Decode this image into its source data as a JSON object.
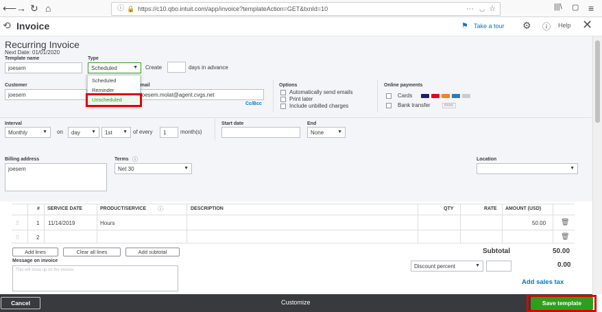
{
  "browser": {
    "url": "https://c10.qbo.intuit.com/app/invoice?templateAction=GET&txnId=10"
  },
  "header": {
    "title": "Invoice",
    "take_tour": "Take a tour",
    "help": "Help"
  },
  "form": {
    "heading": "Recurring Invoice",
    "next_date": "Next Date: 01/01/2020",
    "template_name_label": "Template name",
    "template_name_value": "joesem",
    "type_label": "Type",
    "type_value": "Scheduled",
    "type_options": [
      "Scheduled",
      "Reminder",
      "Unscheduled"
    ],
    "create_label": "Create",
    "days_advance": "days in advance",
    "customer_label": "Customer",
    "customer_value": "joesem",
    "email_label": "Email",
    "email_value": "joesem.molat@agent.cvgs.net",
    "cc_bcc": "Cc/Bcc",
    "options_label": "Options",
    "options": [
      "Automatically send emails",
      "Print later",
      "Include unbilled charges"
    ],
    "online_payments_label": "Online payments",
    "cards": "Cards",
    "bank_transfer": "Bank transfer",
    "bank_logo": "BANK",
    "interval_label": "Interval",
    "interval_value": "Monthly",
    "on_label": "on",
    "day_value": "day",
    "first_value": "1st",
    "of_every": "of every",
    "months_value": "1",
    "months_label": "month(s)",
    "start_date_label": "Start date",
    "end_label": "End",
    "end_value": "None",
    "billing_address_label": "Billing address",
    "billing_address_value": "joesem",
    "terms_label": "Terms",
    "terms_value": "Net 30",
    "location_label": "Location"
  },
  "table": {
    "headers": [
      "#",
      "SERVICE DATE",
      "PRODUCT/SERVICE",
      "DESCRIPTION",
      "QTY",
      "RATE",
      "AMOUNT (USD)"
    ],
    "rows": [
      {
        "num": "1",
        "date": "11/14/2019",
        "product": "Hours",
        "amount": "50.00"
      },
      {
        "num": "2",
        "date": "",
        "product": "",
        "amount": ""
      }
    ],
    "add_lines": "Add lines",
    "clear_lines": "Clear all lines",
    "add_subtotal": "Add subtotal",
    "subtotal_label": "Subtotal",
    "subtotal_value": "50.00",
    "discount_value": "Discount percent",
    "discount_amount": "0.00",
    "message_label": "Message on invoice",
    "message_placeholder": "This will show up on the invoice.",
    "add_sales_tax": "Add sales tax"
  },
  "footer": {
    "cancel": "Cancel",
    "customize": "Customize",
    "save": "Save template"
  },
  "colors": {
    "accent": "#2ca01c",
    "link": "#0077c5",
    "highlight": "#e00000",
    "footer": "#393a3d"
  }
}
